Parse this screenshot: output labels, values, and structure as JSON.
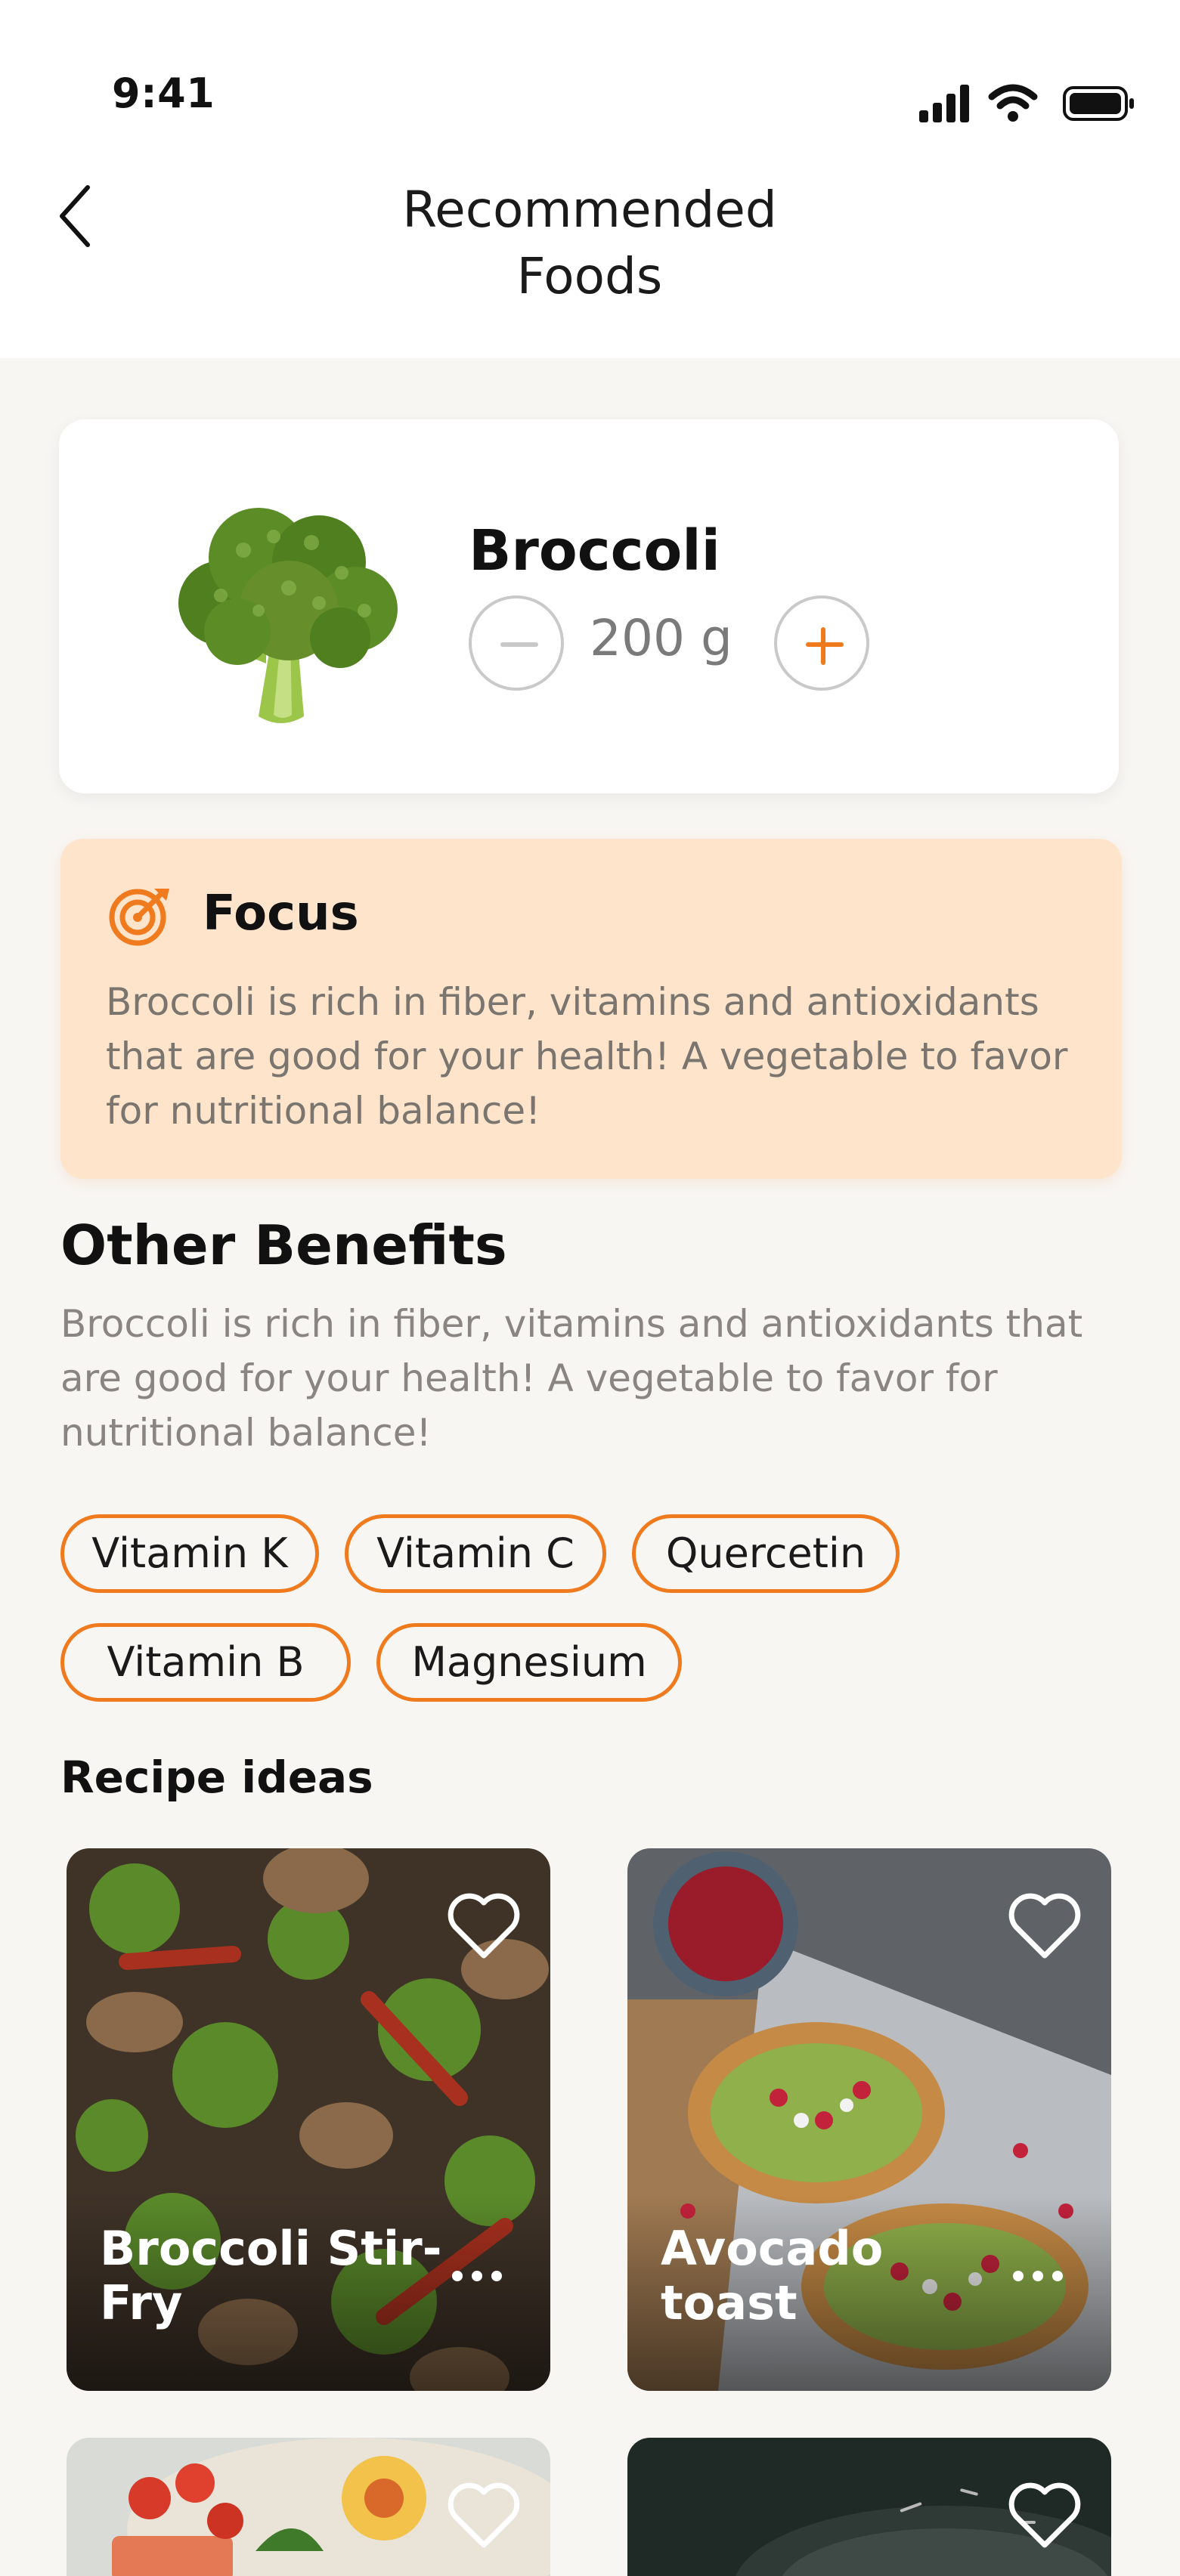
{
  "status_bar": {
    "time": "9:41",
    "icons": [
      "signal-icon",
      "wifi-icon",
      "battery-icon"
    ]
  },
  "header": {
    "title_line1": "Recommended",
    "title_line2": "Foods",
    "back_icon": "chevron-left-icon"
  },
  "food": {
    "name": "Broccoli",
    "quantity": "200 g",
    "image": "broccoli-image"
  },
  "focus": {
    "title": "Focus",
    "icon": "target-icon",
    "text": "Broccoli is rich in fiber, vitamins and antioxidants that are good for your health! A vegetable to favor for nutritional balance!"
  },
  "benefits": {
    "title": "Other Benefits",
    "text": "Broccoli is rich in fiber, vitamins and antioxidants that are good for your health! A vegetable to favor for nutritional balance!",
    "chips": [
      "Vitamin K",
      "Vitamin C",
      "Quercetin",
      "Vitamin B",
      "Magnesium"
    ]
  },
  "recipes": {
    "title": "Recipe ideas",
    "items": [
      {
        "name": "Broccoli Stir-Fry"
      },
      {
        "name": "Avocado toast"
      },
      {
        "name": ""
      },
      {
        "name": ""
      }
    ]
  },
  "colors": {
    "accent": "#f07a1e",
    "focus_bg": "#fde4cb",
    "page_bg": "#f8f6f3"
  }
}
